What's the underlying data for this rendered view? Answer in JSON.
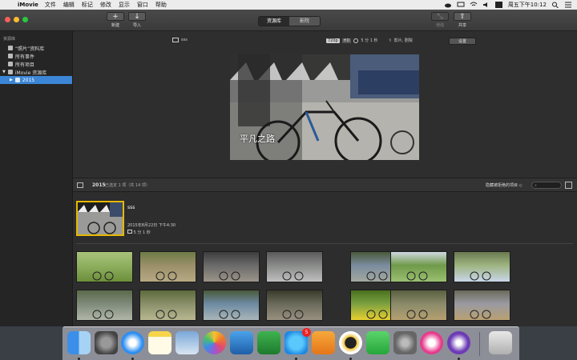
{
  "menubar": {
    "app_name": "iMovie",
    "items": [
      "文件",
      "编辑",
      "标记",
      "修改",
      "显示",
      "窗口",
      "帮助"
    ],
    "clock": "周五下午10:12"
  },
  "toolbar": {
    "new_label": "新建",
    "import_label": "导入",
    "tabs": [
      {
        "label": "资源库",
        "active": true
      },
      {
        "label": "影院",
        "active": false
      }
    ],
    "enhance_label": "增强",
    "share_label": "共享"
  },
  "sidebar": {
    "header": "资源库",
    "items": [
      {
        "label": "“照片”资料库",
        "selected": false
      },
      {
        "label": "所有事件",
        "selected": false
      },
      {
        "label": "所有项目",
        "selected": false
      }
    ],
    "library_label": "iMovie 资源库",
    "year_label": "2015"
  },
  "viewer": {
    "project_name": "sss",
    "resolution": "720p",
    "hd": "HD",
    "duration": "5 分 1 秒",
    "output": "影片, 剧院",
    "settings_label": "设置",
    "title_overlay": "平凡之路"
  },
  "browser_bar": {
    "year": "2015",
    "selection": "已选定 1 项（共 14 项）",
    "filter": "隐藏被拒绝的项目 ◇"
  },
  "project": {
    "name": "sss",
    "date": "2015年8月22日 下午4:30",
    "duration": "5 分 1 秒"
  },
  "clips": [
    {
      "colors": [
        "#8fb060",
        "#6c8f3a",
        "#a9c27a"
      ]
    },
    {
      "colors": [
        "#9a8f6a",
        "#b7a983",
        "#6d7a45"
      ]
    },
    {
      "colors": [
        "#6a6a6a",
        "#9b9488",
        "#3d3d3d"
      ]
    },
    {
      "colors": [
        "#888a88",
        "#bfbfbf",
        "#5a5a5a"
      ]
    },
    {
      "colors": [
        "#7a8c9e",
        "#a3a8a0",
        "#4a5a3a"
      ]
    },
    {
      "colors": [
        "#6f9a4a",
        "#9bc070",
        "#d0d8e0"
      ]
    },
    {
      "colors": [
        "#9eb480",
        "#c9d6ea",
        "#6a7a50"
      ]
    },
    {
      "colors": [
        "#7f8a7a",
        "#b0b7a8",
        "#5a6a4a"
      ]
    },
    {
      "colors": [
        "#8a8f6a",
        "#b8b890",
        "#5c6a3a"
      ]
    },
    {
      "colors": [
        "#6d8aa2",
        "#aab6b8",
        "#4a5a3a"
      ]
    },
    {
      "colors": [
        "#6a6a5a",
        "#999080",
        "#3a3a2a"
      ]
    },
    {
      "colors": [
        "#7aa040",
        "#e8d030",
        "#4a7020"
      ]
    },
    {
      "colors": [
        "#8a8a6a",
        "#b5a070",
        "#5a6040"
      ]
    },
    {
      "colors": [
        "#9a9aa2",
        "#b8a070",
        "#6a6a5a"
      ]
    }
  ],
  "dock": {
    "messages_badge": "5",
    "icons": [
      "finder-icon",
      "launchpad-icon",
      "safari-icon",
      "notes-icon",
      "preview-icon",
      "photos-icon",
      "keynote-icon",
      "numbers-icon",
      "messages-icon",
      "pages-icon",
      "qq-icon",
      "facetime-icon",
      "system-preferences-icon",
      "itunes-icon",
      "imovie-icon",
      "trash-icon"
    ]
  }
}
